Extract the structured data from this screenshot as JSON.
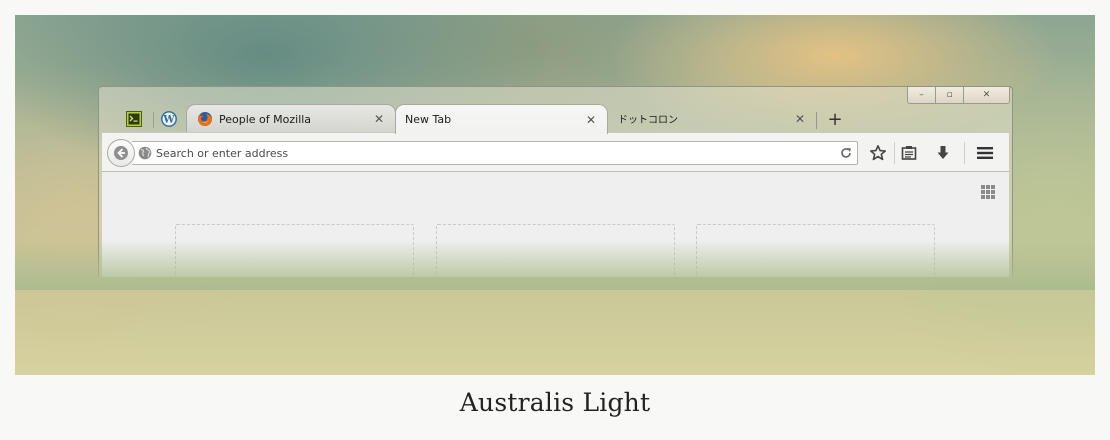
{
  "window": {
    "controls": {
      "minimize": "–",
      "maximize": "▫",
      "close": "✕"
    }
  },
  "tabs": [
    {
      "label": "People of Mozilla",
      "favicon": "firefox-icon",
      "state": "background"
    },
    {
      "label": "New Tab",
      "favicon": "none",
      "state": "active"
    },
    {
      "label": "ドットコロン",
      "favicon": "none",
      "state": "background"
    }
  ],
  "pinned_tabs": [
    {
      "favicon": "terminal-icon"
    },
    {
      "favicon": "wordpress-icon"
    }
  ],
  "tab_close_glyph": "✕",
  "new_tab_glyph": "+",
  "navbar": {
    "address_placeholder": "Search or enter address",
    "buttons": [
      "back-icon",
      "reload-icon",
      "bookmark-star-icon",
      "reading-list-icon",
      "download-icon",
      "menu-icon"
    ]
  },
  "content": {
    "tiles": 3
  },
  "caption": "Australis Light",
  "colors": {
    "active_tab": "#f6f6f5",
    "toolbar": "#f3f3f2",
    "content_bg": "#efefef",
    "icon_dark": "#444444"
  }
}
